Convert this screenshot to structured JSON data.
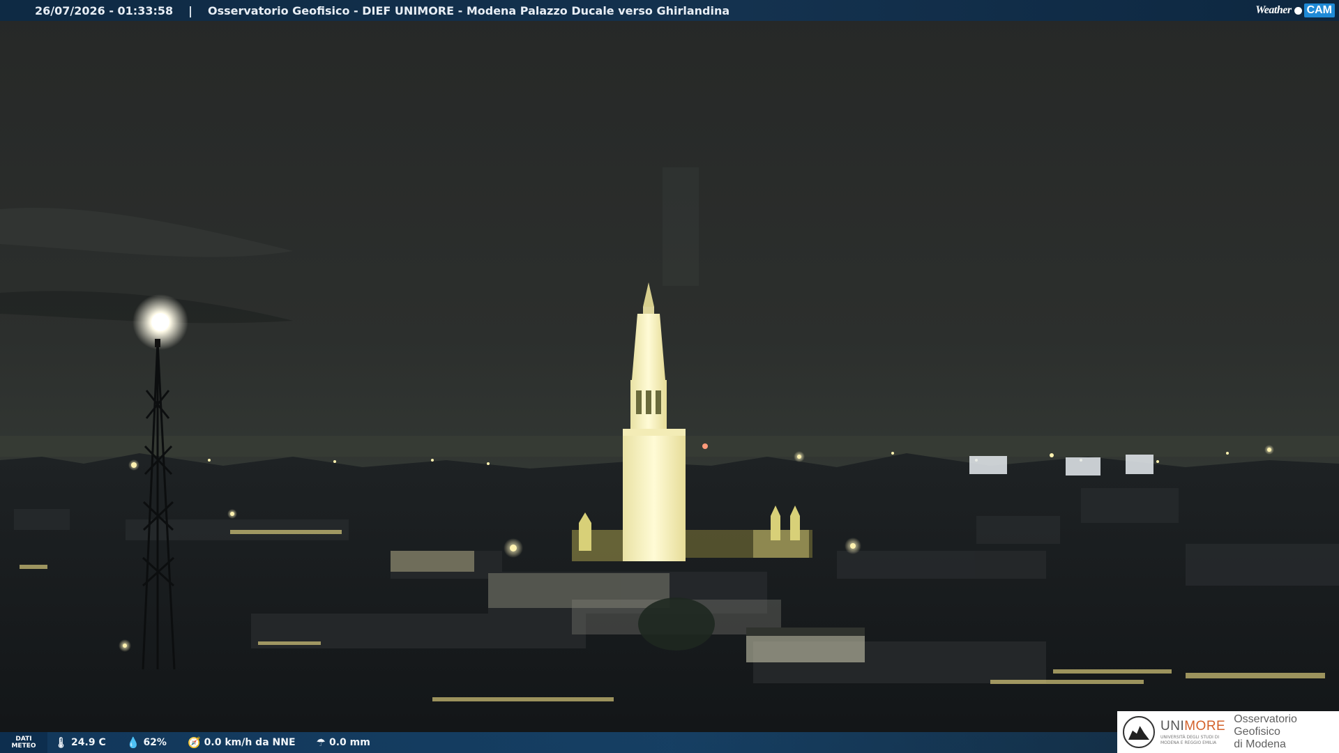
{
  "header": {
    "timestamp": "26/07/2026 - 01:33:58",
    "separator": "|",
    "title": "Osservatorio Geofisico - DIEF UNIMORE - Modena Palazzo Ducale verso Ghirlandina"
  },
  "brand": {
    "weather": "Weather",
    "cam": "CAM"
  },
  "weather": {
    "label_line1": "DATI",
    "label_line2": "METEO",
    "temperature": "24.9 C",
    "humidity": "62%",
    "wind": "0.0 km/h da NNE",
    "rain": "0.0 mm"
  },
  "logo": {
    "uni_prefix": "UNI",
    "uni_suffix": "MORE",
    "uni_sub_line1": "UNIVERSITÀ DEGLI STUDI DI",
    "uni_sub_line2": "MODENA E REGGIO EMILIA",
    "obs_line1": "Osservatorio Geofisico",
    "obs_line2": "di Modena"
  },
  "colors": {
    "sky": "#2a2d2b",
    "tower_light": "#f6efb8",
    "city_lights": "#ffe9a0",
    "bar_blue": "#14324f",
    "unimore_orange": "#d3612a"
  }
}
